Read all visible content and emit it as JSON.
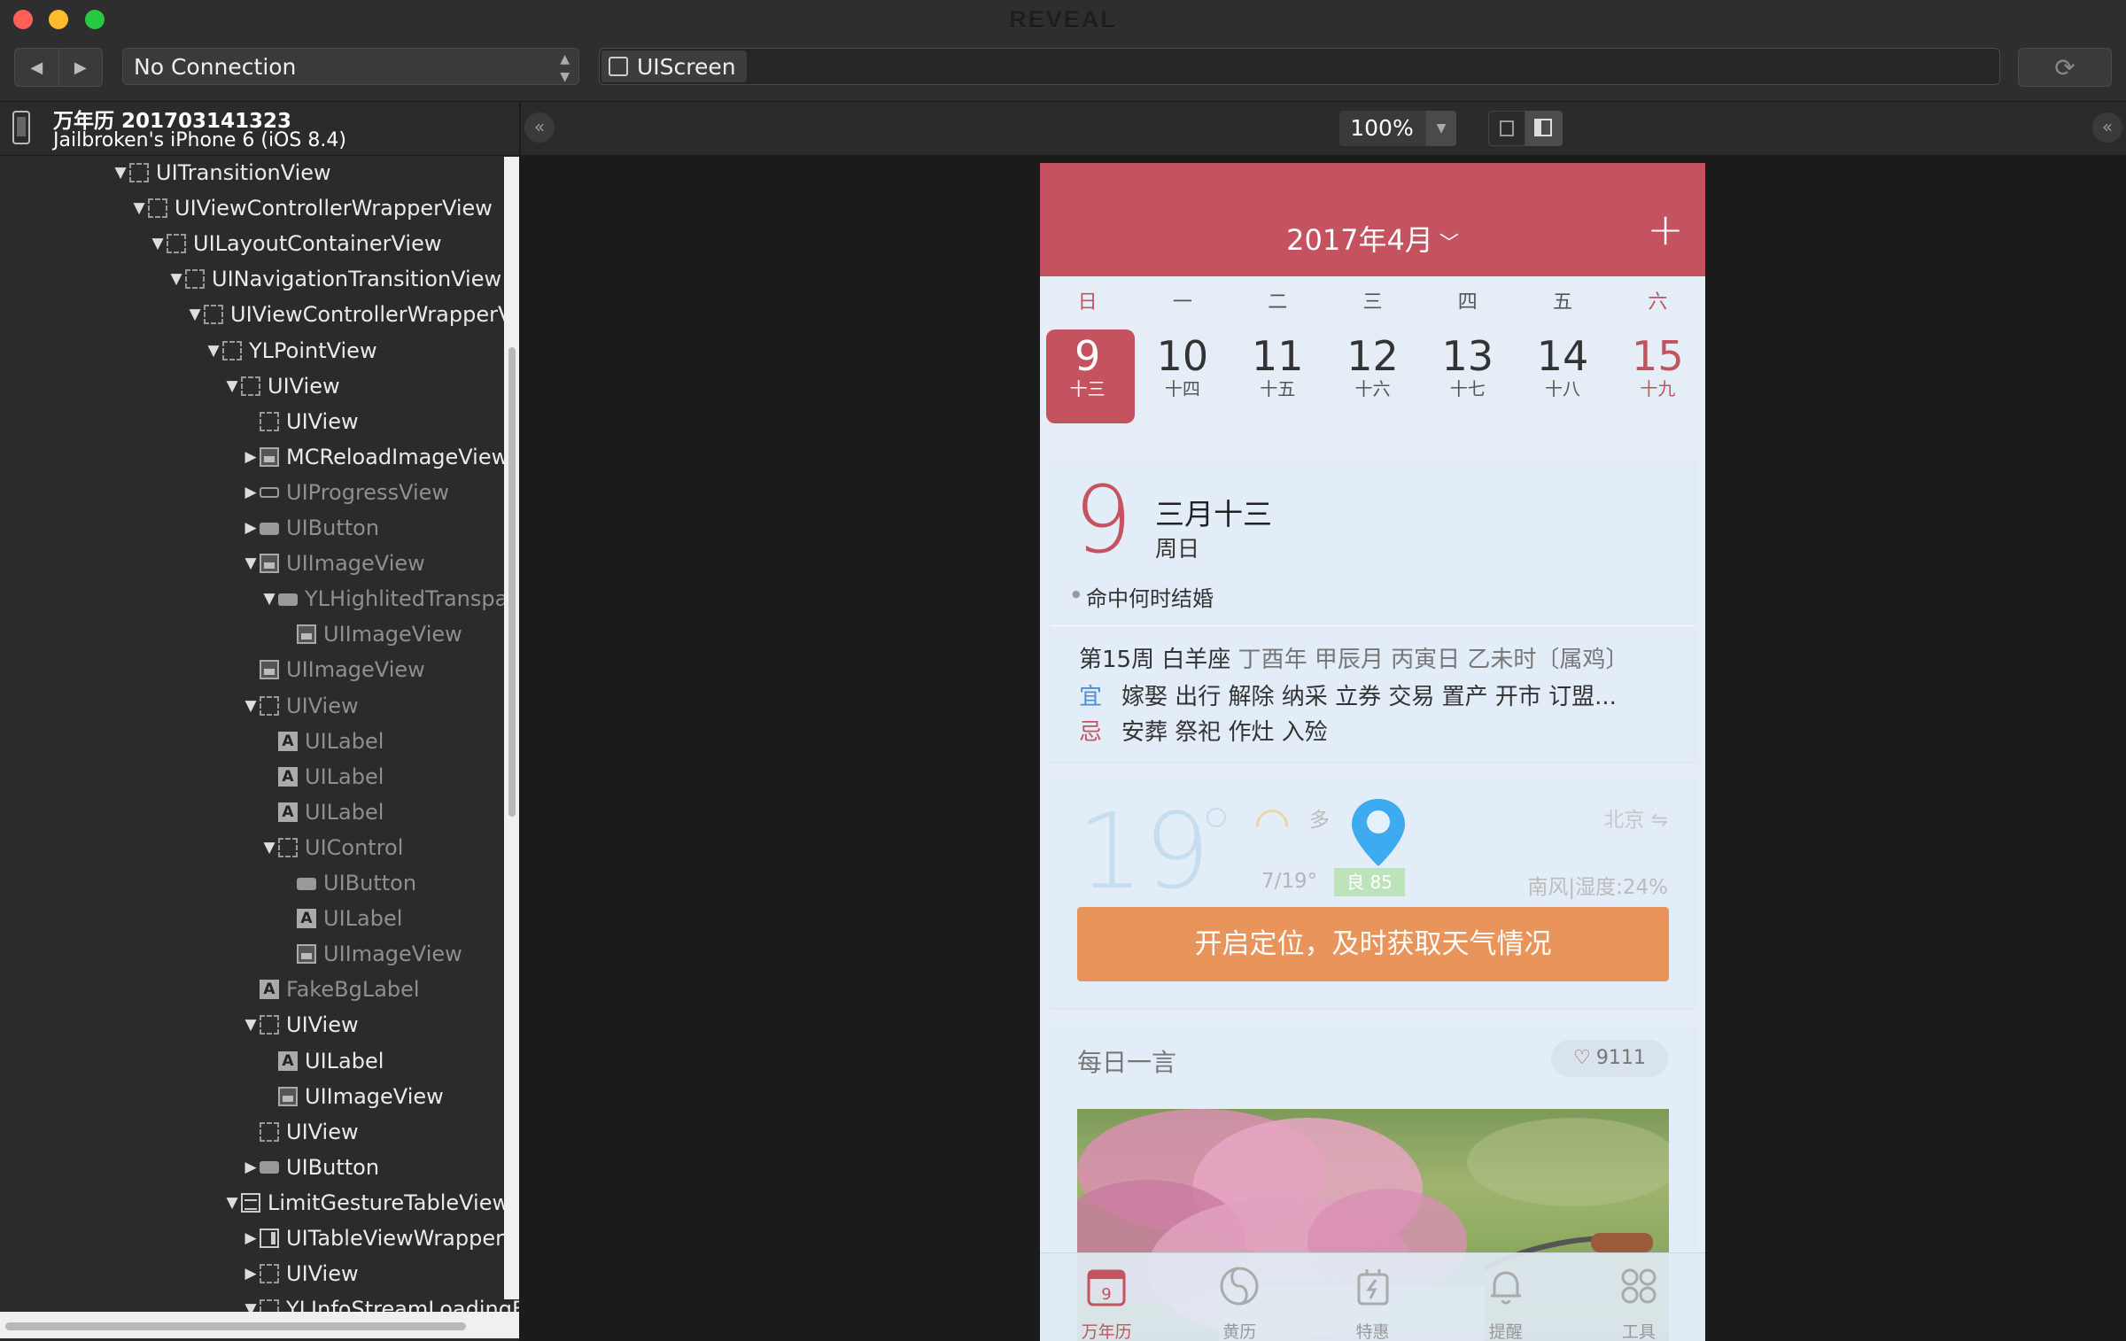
{
  "window": {
    "title": "REVEAL"
  },
  "toolbar": {
    "connection": "No Connection",
    "breadcrumb": "UIScreen"
  },
  "device": {
    "app": "万年历 201703141323",
    "name": "Jailbroken's iPhone 6 (iOS 8.4)"
  },
  "tree": [
    {
      "label": "UITransitionView",
      "icon": "dash",
      "depth": 0,
      "tri": "open",
      "dim": false
    },
    {
      "label": "UIViewControllerWrapperView",
      "icon": "dash",
      "depth": 1,
      "tri": "open",
      "dim": false
    },
    {
      "label": "UILayoutContainerView",
      "icon": "dash",
      "depth": 2,
      "tri": "open",
      "dim": false
    },
    {
      "label": "UINavigationTransitionView",
      "icon": "dash",
      "depth": 3,
      "tri": "open",
      "dim": false
    },
    {
      "label": "UIViewControllerWrapperView",
      "icon": "dash",
      "depth": 4,
      "tri": "open",
      "dim": false
    },
    {
      "label": "YLPointView",
      "icon": "dash",
      "depth": 5,
      "tri": "open",
      "dim": false
    },
    {
      "label": "UIView",
      "icon": "dash",
      "depth": 6,
      "tri": "open",
      "dim": false
    },
    {
      "label": "UIView",
      "icon": "dash",
      "depth": 7,
      "tri": "",
      "dim": false
    },
    {
      "label": "MCReloadImageView",
      "icon": "img",
      "depth": 7,
      "tri": "closed",
      "dim": false
    },
    {
      "label": "UIProgressView",
      "icon": "prog",
      "depth": 7,
      "tri": "closed",
      "dim": true
    },
    {
      "label": "UIButton",
      "icon": "btn",
      "depth": 7,
      "tri": "closed",
      "dim": true
    },
    {
      "label": "UIImageView",
      "icon": "img",
      "depth": 7,
      "tri": "open",
      "dim": true
    },
    {
      "label": "YLHighlitedTransparencyButton",
      "icon": "btn",
      "depth": 8,
      "tri": "open",
      "dim": true
    },
    {
      "label": "UIImageView",
      "icon": "img",
      "depth": 9,
      "tri": "",
      "dim": true
    },
    {
      "label": "UIImageView",
      "icon": "img",
      "depth": 7,
      "tri": "",
      "dim": true
    },
    {
      "label": "UIView",
      "icon": "dash",
      "depth": 7,
      "tri": "open",
      "dim": true
    },
    {
      "label": "UILabel",
      "icon": "lbl",
      "depth": 8,
      "tri": "",
      "dim": true
    },
    {
      "label": "UILabel",
      "icon": "lbl",
      "depth": 8,
      "tri": "",
      "dim": true
    },
    {
      "label": "UILabel",
      "icon": "lbl",
      "depth": 8,
      "tri": "",
      "dim": true
    },
    {
      "label": "UIControl",
      "icon": "dash",
      "depth": 8,
      "tri": "open",
      "dim": true
    },
    {
      "label": "UIButton",
      "icon": "btn",
      "depth": 9,
      "tri": "",
      "dim": true
    },
    {
      "label": "UILabel",
      "icon": "lbl",
      "depth": 9,
      "tri": "",
      "dim": true
    },
    {
      "label": "UIImageView",
      "icon": "img",
      "depth": 9,
      "tri": "",
      "dim": true
    },
    {
      "label": "FakeBgLabel",
      "icon": "lbl",
      "depth": 7,
      "tri": "",
      "dim": true
    },
    {
      "label": "UIView",
      "icon": "dash",
      "depth": 7,
      "tri": "open",
      "dim": false
    },
    {
      "label": "UILabel",
      "icon": "lbl",
      "depth": 8,
      "tri": "",
      "dim": false
    },
    {
      "label": "UIImageView",
      "icon": "img",
      "depth": 8,
      "tri": "",
      "dim": false
    },
    {
      "label": "UIView",
      "icon": "dash",
      "depth": 7,
      "tri": "",
      "dim": false
    },
    {
      "label": "UIButton",
      "icon": "btn",
      "depth": 7,
      "tri": "closed",
      "dim": false
    },
    {
      "label": "LimitGestureTableView",
      "icon": "tbl",
      "depth": 6,
      "tri": "open",
      "dim": false
    },
    {
      "label": "UITableViewWrapperView",
      "icon": "wrap",
      "depth": 7,
      "tri": "closed",
      "dim": false
    },
    {
      "label": "UIView",
      "icon": "dash",
      "depth": 7,
      "tri": "closed",
      "dim": false
    },
    {
      "label": "YLInfoStreamLoadingFooter",
      "icon": "dash",
      "depth": 7,
      "tri": "open",
      "dim": false
    }
  ],
  "canvas": {
    "zoom": "100%"
  },
  "phone": {
    "header_title": "2017年4月",
    "weekdays": [
      "日",
      "一",
      "二",
      "三",
      "四",
      "五",
      "六"
    ],
    "days": [
      {
        "num": "9",
        "lunar": "十三",
        "state": "selected"
      },
      {
        "num": "10",
        "lunar": "十四",
        "state": ""
      },
      {
        "num": "11",
        "lunar": "十五",
        "state": ""
      },
      {
        "num": "12",
        "lunar": "十六",
        "state": ""
      },
      {
        "num": "13",
        "lunar": "十七",
        "state": ""
      },
      {
        "num": "14",
        "lunar": "十八",
        "state": ""
      },
      {
        "num": "15",
        "lunar": "十九",
        "state": "red"
      }
    ],
    "detail": {
      "big_day": "9",
      "lunar_date": "三月十三",
      "weekday": "周日",
      "tip": "命中何时结婚",
      "week_info": "第15周 白羊座",
      "ganzhi": "丁酉年 甲辰月 丙寅日 乙未时〔属鸡〕",
      "yi_tag": "宜",
      "yi": "嫁娶 出行 解除 纳采 立券 交易 置产 开市 订盟...",
      "ji_tag": "忌",
      "ji": "安葬 祭祀 作灶 入殓"
    },
    "weather": {
      "temp": "19",
      "condition": "多",
      "city": "北京 ⇋",
      "range": "7/19°",
      "aqi": "良 85",
      "wind": "南风|湿度:24%",
      "location_button": "开启定位，及时获取天气情况"
    },
    "daily": {
      "title": "每日一言",
      "likes": "9111"
    },
    "tabs": [
      {
        "label": "万年历",
        "icon": "calendar-icon",
        "badge": "9"
      },
      {
        "label": "黄历",
        "icon": "yinyang-icon"
      },
      {
        "label": "特惠",
        "icon": "gift-icon"
      },
      {
        "label": "提醒",
        "icon": "bell-icon"
      },
      {
        "label": "工具",
        "icon": "grid-icon"
      }
    ]
  },
  "colors": {
    "accent": "#c4525f",
    "orange": "#e8945a",
    "blue": "#4a8fd6"
  }
}
